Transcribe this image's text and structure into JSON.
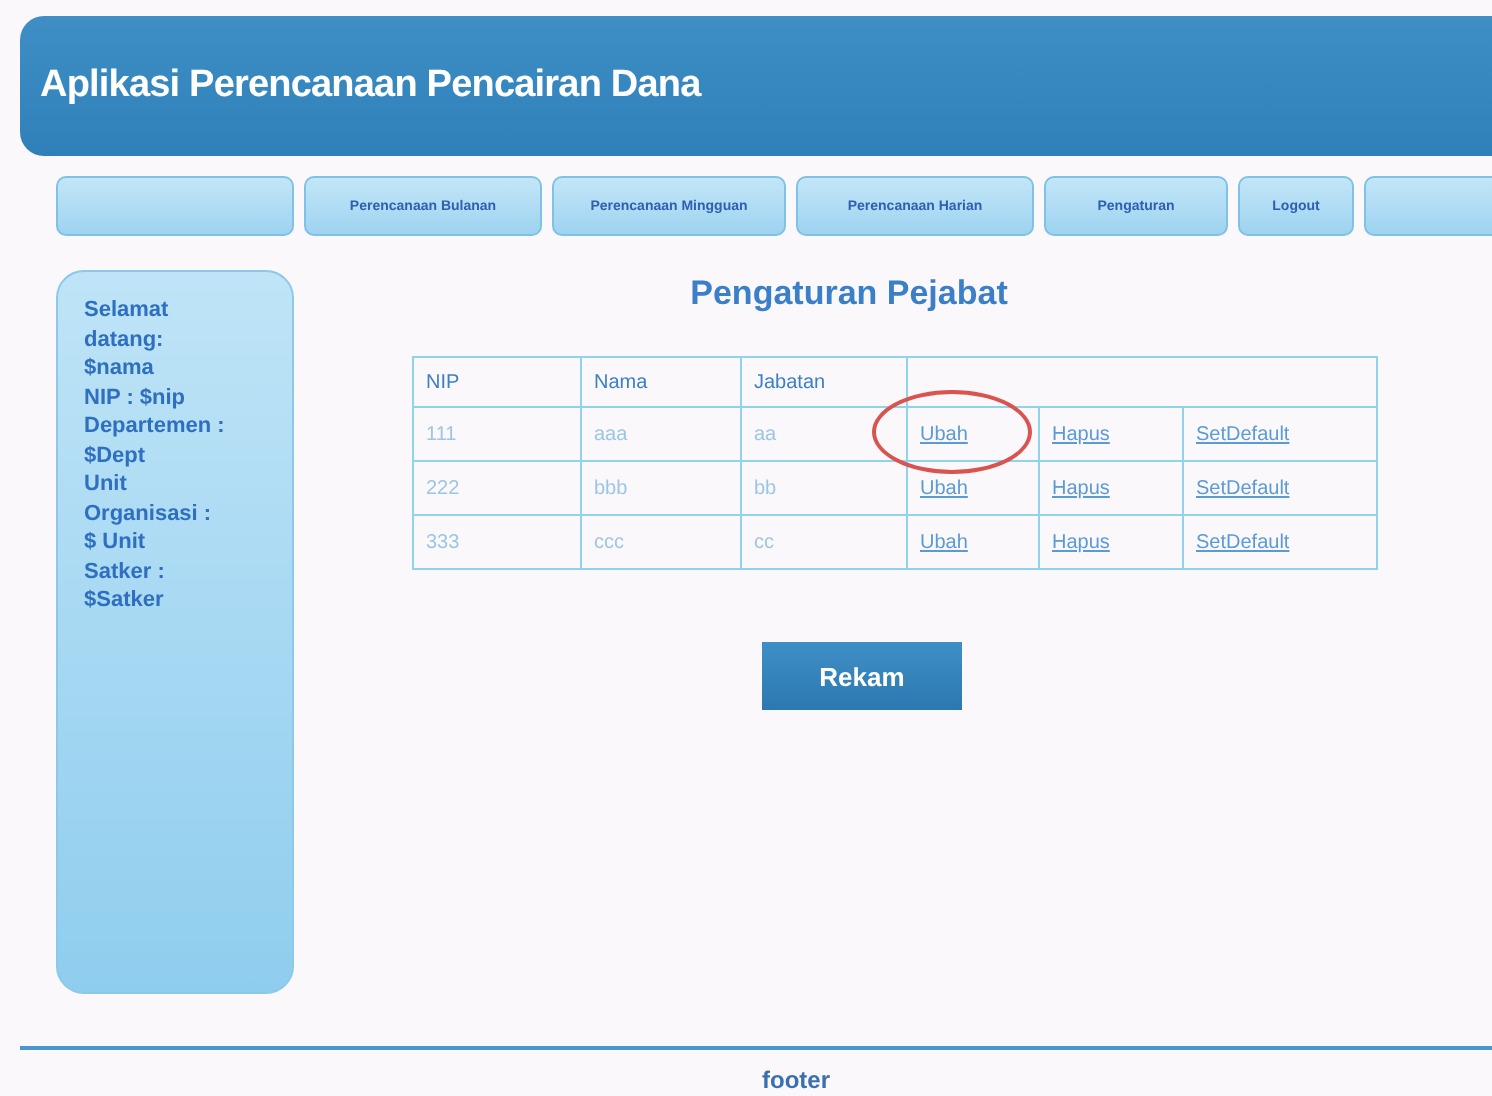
{
  "header": {
    "title": "Aplikasi Perencanaan Pencairan Dana"
  },
  "nav": [
    {
      "kind": "blank"
    },
    {
      "kind": "link",
      "label": "Perencanaan Bulanan"
    },
    {
      "kind": "link",
      "label": "Perencanaan Mingguan"
    },
    {
      "kind": "link",
      "label": "Perencanaan Harian"
    },
    {
      "kind": "link",
      "label": "Pengaturan"
    },
    {
      "kind": "link",
      "label": "Logout"
    },
    {
      "kind": "blank"
    }
  ],
  "sidebar": {
    "lines": [
      "Selamat",
      "datang:",
      "$nama",
      "NIP : $nip",
      "Departemen :",
      "$Dept",
      "Unit",
      "Organisasi :",
      "$ Unit",
      "Satker :",
      "$Satker"
    ]
  },
  "page_title": "Pengaturan Pejabat",
  "table": {
    "columns": [
      "NIP",
      "Nama",
      "Jabatan"
    ],
    "rows": [
      {
        "cells": [
          "111",
          "aaa",
          "aa"
        ],
        "links": [
          {
            "text": "Ubah",
            "circled": true
          },
          {
            "text": "Hapus",
            "circled": false
          },
          {
            "text": "SetDefault",
            "circled": false
          }
        ]
      },
      {
        "cells": [
          "222",
          "bbb",
          "bb"
        ],
        "links": [
          {
            "text": "Ubah",
            "circled": false
          },
          {
            "text": "Hapus",
            "circled": false
          },
          {
            "text": "SetDefault",
            "circled": false
          }
        ]
      },
      {
        "cells": [
          "333",
          "ccc",
          "cc"
        ],
        "links": [
          {
            "text": "Ubah",
            "circled": false
          },
          {
            "text": "Hapus",
            "circled": false
          },
          {
            "text": "SetDefault",
            "circled": false
          }
        ]
      }
    ]
  },
  "button": "Rekam",
  "footer": "footer"
}
